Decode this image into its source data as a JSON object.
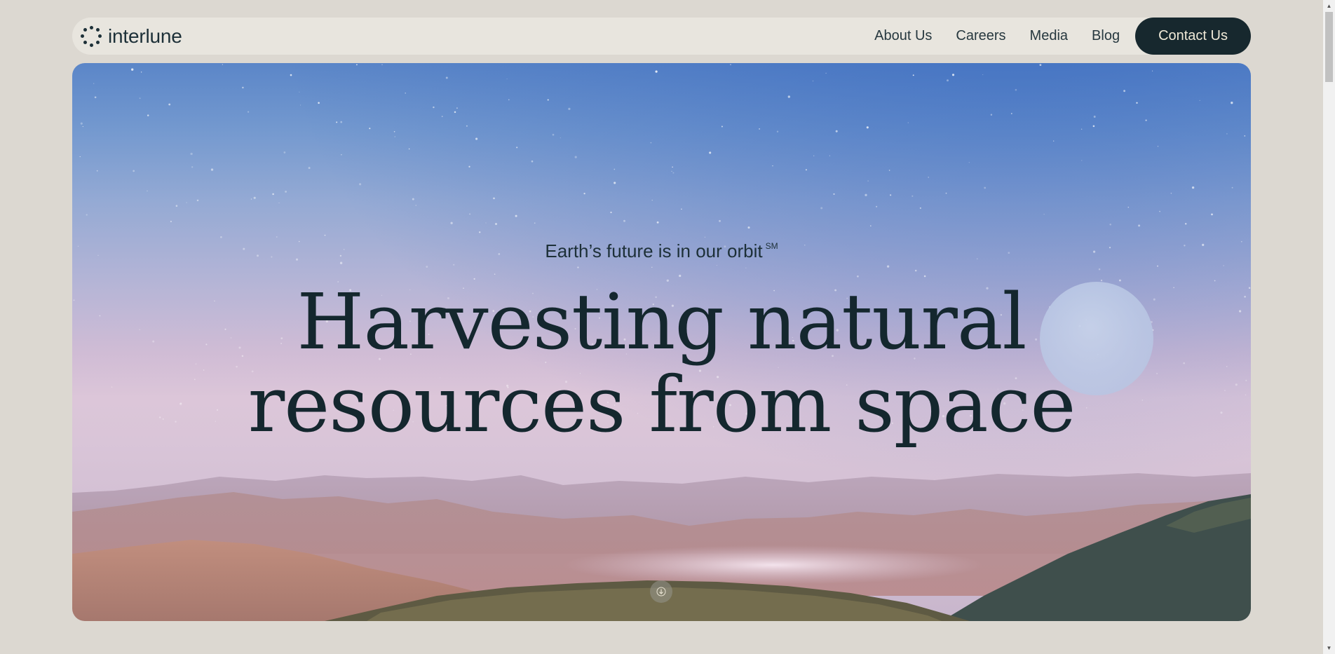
{
  "header": {
    "brand": "interlune",
    "nav": [
      "About Us",
      "Careers",
      "Media",
      "Blog"
    ],
    "cta": "Contact Us"
  },
  "hero": {
    "tagline": "Earth’s future is in our orbit",
    "tagline_mark": "SM",
    "headline_line1": "Harvesting natural",
    "headline_line2": "resources from space"
  },
  "icons": {
    "logo": "dotted-circle-logo-icon",
    "scroll": "arrow-down-icon"
  },
  "colors": {
    "background": "#dcd8d1",
    "nav_bg": "#e8e5de",
    "text_dark": "#14272e",
    "cta_bg": "#17282e",
    "cta_text": "#f0ead8"
  }
}
